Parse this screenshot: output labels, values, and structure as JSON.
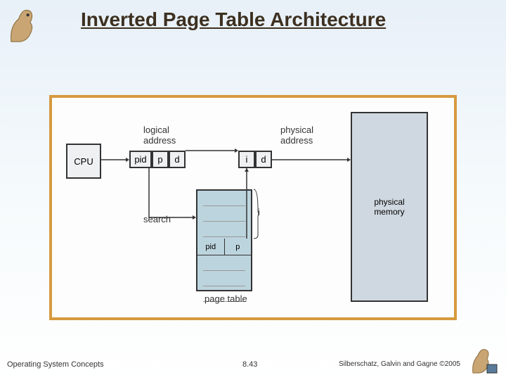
{
  "title": "Inverted Page Table Architecture",
  "diagram": {
    "cpu": "CPU",
    "logical_address_label": "logical\naddress",
    "physical_address_label": "physical\naddress",
    "pid": "pid",
    "p": "p",
    "d": "d",
    "i": "i",
    "physical_memory": "physical\nmemory",
    "search": "search",
    "page_table": "page table",
    "i_brace": "i"
  },
  "footer": {
    "left": "Operating System Concepts",
    "mid": "8.43",
    "right": "Silberschatz, Galvin and Gagne ©2005"
  }
}
